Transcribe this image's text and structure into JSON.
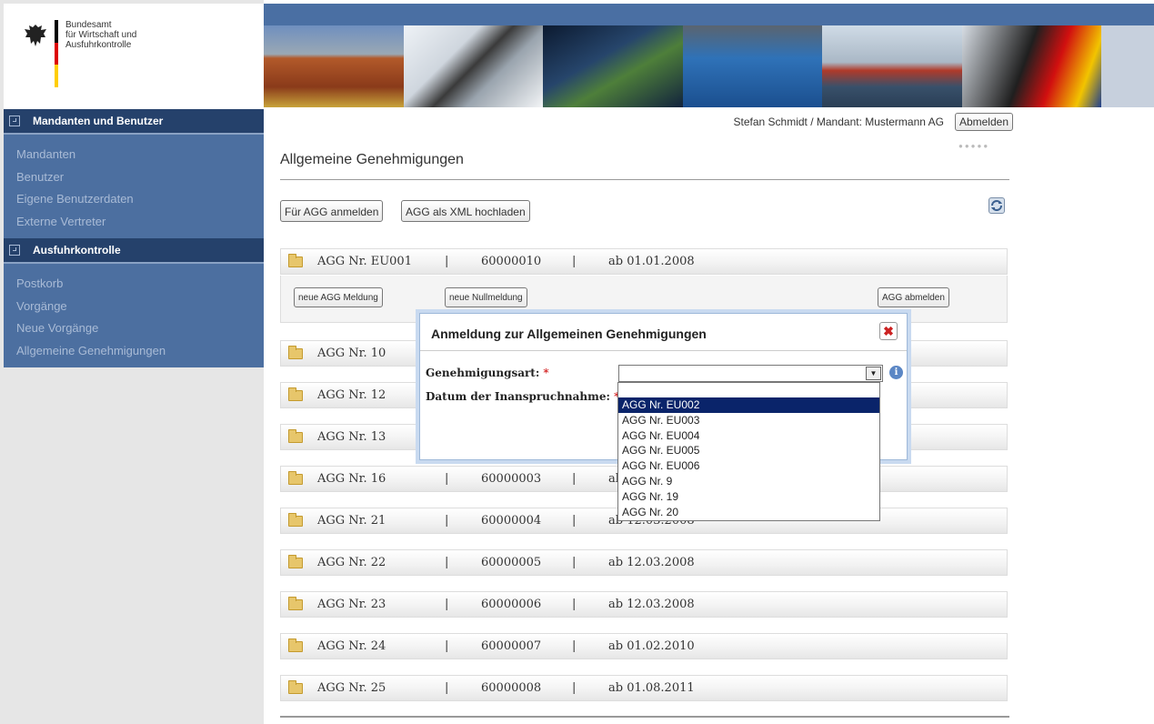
{
  "logo": {
    "line1": "Bundesamt",
    "line2": "für Wirtschaft und",
    "line3": "Ausfuhrkontrolle"
  },
  "sidebar": {
    "sections": [
      {
        "title": "Mandanten und Benutzer",
        "items": [
          "Mandanten",
          "Benutzer",
          "Eigene Benutzerdaten",
          "Externe Vertreter"
        ]
      },
      {
        "title": "Ausfuhrkontrolle",
        "items": [
          "Postkorb",
          "Vorgänge",
          "Neue Vorgänge",
          "Allgemeine Genehmigungen"
        ]
      }
    ]
  },
  "userbar": {
    "user": "Stefan Schmidt / Mandant: Mustermann AG",
    "logout": "Abmelden"
  },
  "page": {
    "title": "Allgemeine Genehmigungen"
  },
  "toolbar": {
    "register": "Für AGG anmelden",
    "upload": "AGG als XML hochladen"
  },
  "rows": [
    {
      "name": "AGG Nr. EU001",
      "sep1": "|",
      "number": "60000010",
      "sep2": "|",
      "date": "ab 01.01.2008"
    },
    {
      "name": "AGG Nr. 10",
      "sep1": "",
      "number": "",
      "sep2": "",
      "date": ""
    },
    {
      "name": "AGG Nr. 12",
      "sep1": "",
      "number": "",
      "sep2": "",
      "date": ""
    },
    {
      "name": "AGG Nr. 13",
      "sep1": "",
      "number": "",
      "sep2": "",
      "date": ""
    },
    {
      "name": "AGG Nr. 16",
      "sep1": "|",
      "number": "60000003",
      "sep2": "|",
      "date": "ab"
    },
    {
      "name": "AGG Nr. 21",
      "sep1": "|",
      "number": "60000004",
      "sep2": "|",
      "date": "ab 12.03.2008"
    },
    {
      "name": "AGG Nr. 22",
      "sep1": "|",
      "number": "60000005",
      "sep2": "|",
      "date": "ab 12.03.2008"
    },
    {
      "name": "AGG Nr. 23",
      "sep1": "|",
      "number": "60000006",
      "sep2": "|",
      "date": "ab 12.03.2008"
    },
    {
      "name": "AGG Nr. 24",
      "sep1": "|",
      "number": "60000007",
      "sep2": "|",
      "date": "ab 01.02.2010"
    },
    {
      "name": "AGG Nr. 25",
      "sep1": "|",
      "number": "60000008",
      "sep2": "|",
      "date": "ab 01.08.2011"
    }
  ],
  "expanded": {
    "new_report": "neue AGG Meldung",
    "null_report": "neue Nullmeldung",
    "deregister": "AGG abmelden"
  },
  "dialog": {
    "title": "Anmeldung zur Allgemeinen Genehmigungen",
    "close": "✖",
    "label_type": "Genehmigungsart:",
    "label_date": "Datum der Inanspruchnahme:",
    "required": "*",
    "select_value": "",
    "options": [
      "AGG Nr. EU002",
      "AGG Nr. EU003",
      "AGG Nr. EU004",
      "AGG Nr. EU005",
      "AGG Nr. EU006",
      "AGG Nr. 9",
      "AGG Nr. 19",
      "AGG Nr. 20"
    ],
    "selected_option": "AGG Nr. EU002"
  },
  "colors": {
    "nav_dark": "#25416b",
    "nav": "#4c6fa0",
    "header": "#4a6fa3",
    "flag_black": "#000000",
    "flag_red": "#dd0000",
    "flag_gold": "#ffce00"
  },
  "icons": {
    "logo": "federal-eagle-icon",
    "refresh": "refresh-icon",
    "folder": "folder-icon",
    "info": "info-icon",
    "close": "close-icon"
  }
}
